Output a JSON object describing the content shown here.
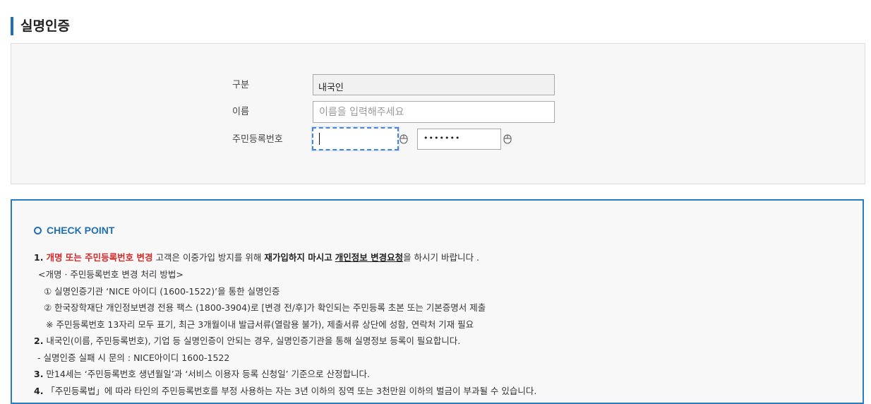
{
  "page_title": "실명인증",
  "form": {
    "type_label": "구분",
    "type_value": "내국인",
    "name_label": "이름",
    "name_placeholder": "이름을 입력해주세요",
    "rrn_label": "주민등록번호",
    "rrn_separator": "-",
    "rrn_back_value": "•••••••"
  },
  "checkpoint": {
    "title": "CHECK POINT",
    "item1": {
      "num": "1.",
      "highlight": "개명 또는 주민등록번호 변경",
      "text_a": " 고객은 이중가입 방지를 위해 ",
      "bold": "재가입하지 마시고",
      "text_b": " ",
      "underline": "개인정보 변경요청",
      "text_c": "을 하시기 바랍니다 ."
    },
    "item1_sub": [
      "<개명 · 주민등록번호 변경 처리 방법>",
      "① 실명인증기관 ‘NICE 아이디 (1600-1522)’을 통한 실명인증",
      "② 한국장학재단 개인정보변경 전용 팩스 (1800-3904)로 [변경 전/후]가 확인되는 주민등록 초본 또는 기본증명서 제출",
      "※ 주민등록번호 13자리 모두 표기, 최근 3개월이내 발급서류(열람용 불가), 제출서류 상단에 성함, 연락처 기재 필요"
    ],
    "item2": {
      "num": "2.",
      "text": " 내국인(이름, 주민등록번호), 기업 등 실명인증이 안되는 경우, 실명인증기관을 통해 실명정보 등록이 필요합니다."
    },
    "item2_sub": "- 실명인증 실패 시 문의 : NICE아이디 1600-1522",
    "item3": {
      "num": "3.",
      "text": " 만14세는 ‘주민등록번호 생년월일’과 ‘서비스 이용자 등록 신청일’ 기준으로 산정합니다."
    },
    "item4": {
      "num": "4.",
      "text": " 「주민등록법」에 따라 타인의 주민등록번호를 부정 사용하는 자는 3년 이하의 징역 또는 3천만원 이하의 벌금이 부과될 수 있습니다."
    }
  }
}
